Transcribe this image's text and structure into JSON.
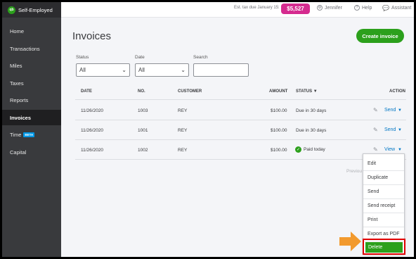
{
  "app": {
    "name": "Self-Employed",
    "logo_text": "qb"
  },
  "sidebar": {
    "items": [
      {
        "label": "Home"
      },
      {
        "label": "Transactions"
      },
      {
        "label": "Miles"
      },
      {
        "label": "Taxes"
      },
      {
        "label": "Reports"
      },
      {
        "label": "Invoices",
        "active": true
      },
      {
        "label": "Time",
        "badge": "BETA"
      },
      {
        "label": "Capital"
      }
    ]
  },
  "topbar": {
    "tax_label": "Est. tax due January 15:",
    "tax_amount": "$5,527",
    "user": "Jennifer",
    "help": "Help",
    "assistant": "Assistant"
  },
  "page": {
    "title": "Invoices",
    "create_button": "Create invoice"
  },
  "filters": {
    "status_label": "Status",
    "status_value": "All",
    "date_label": "Date",
    "date_value": "All",
    "search_label": "Search",
    "search_value": ""
  },
  "table": {
    "headers": {
      "date": "DATE",
      "no": "NO.",
      "customer": "CUSTOMER",
      "amount": "AMOUNT",
      "status": "STATUS ▼",
      "action": "ACTION"
    },
    "rows": [
      {
        "date": "11/26/2020",
        "no": "1003",
        "customer": "REY",
        "amount": "$100.00",
        "status": "Due in 30 days",
        "action": "Send"
      },
      {
        "date": "11/26/2020",
        "no": "1001",
        "customer": "REY",
        "amount": "$100.00",
        "status": "Due in 30 days",
        "action": "Send"
      },
      {
        "date": "11/26/2020",
        "no": "1002",
        "customer": "REY",
        "amount": "$100.00",
        "status": "Paid today",
        "action": "View"
      }
    ],
    "pagination_partial": "Previou"
  },
  "action_menu": {
    "items": [
      "Edit",
      "Duplicate",
      "Send",
      "Send receipt",
      "Print",
      "Export as PDF",
      "Delete"
    ]
  },
  "colors": {
    "accent": "#2ca01c",
    "tax_pill": "#d52b8f",
    "link": "#0077c5",
    "sidebar": "#393a3d",
    "highlight": "#e00000",
    "arrow": "#f29a2e"
  }
}
